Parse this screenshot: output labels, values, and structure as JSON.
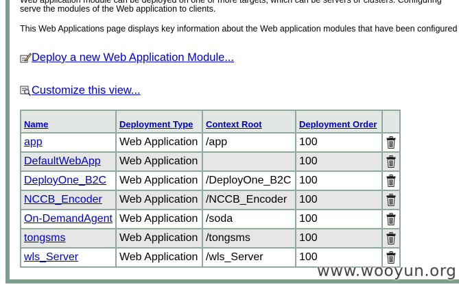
{
  "intro": {
    "line1": "Web application module can be deployed on one or more targets, which can be servers or clusters. Configuring",
    "line2": "serve the modules of the Web application to clients.",
    "line3": "This Web Applications page displays key information about the Web application modules that have been configured"
  },
  "actions": {
    "deploy_label": "Deploy a new Web Application Module...",
    "deploy_icon": "edit-pencil-icon",
    "customize_label": "Customize this view...",
    "customize_icon": "customize-view-icon"
  },
  "table": {
    "headers": {
      "name": "Name",
      "type": "Deployment Type",
      "context": "Context Root",
      "order": "Deployment Order"
    },
    "rows": [
      {
        "name": "app",
        "type": "Web Application",
        "context": "/app",
        "order": "100"
      },
      {
        "name": "DefaultWebApp",
        "type": "Web Application",
        "context": "",
        "order": "100"
      },
      {
        "name": "DeployOne_B2C",
        "type": "Web Application",
        "context": "/DeployOne_B2C",
        "order": "100"
      },
      {
        "name": "NCCB_Encoder",
        "type": "Web Application",
        "context": "/NCCB_Encoder",
        "order": "100"
      },
      {
        "name": "On-DemandAgent",
        "type": "Web Application",
        "context": "/soda",
        "order": "100"
      },
      {
        "name": "tongsms",
        "type": "Web Application",
        "context": "/tongsms",
        "order": "100"
      },
      {
        "name": "wls_Server",
        "type": "Web Application",
        "context": "/wls_Server",
        "order": "100"
      }
    ],
    "delete_icon": "trash-icon"
  },
  "watermark": "www.wooyun.org",
  "colors": {
    "link": "#0000cc",
    "header_bg": "#e2e7e4",
    "table_border": "#8faa9a",
    "alt_row": "#e6e6e6",
    "frame": "#7f9e8b"
  }
}
